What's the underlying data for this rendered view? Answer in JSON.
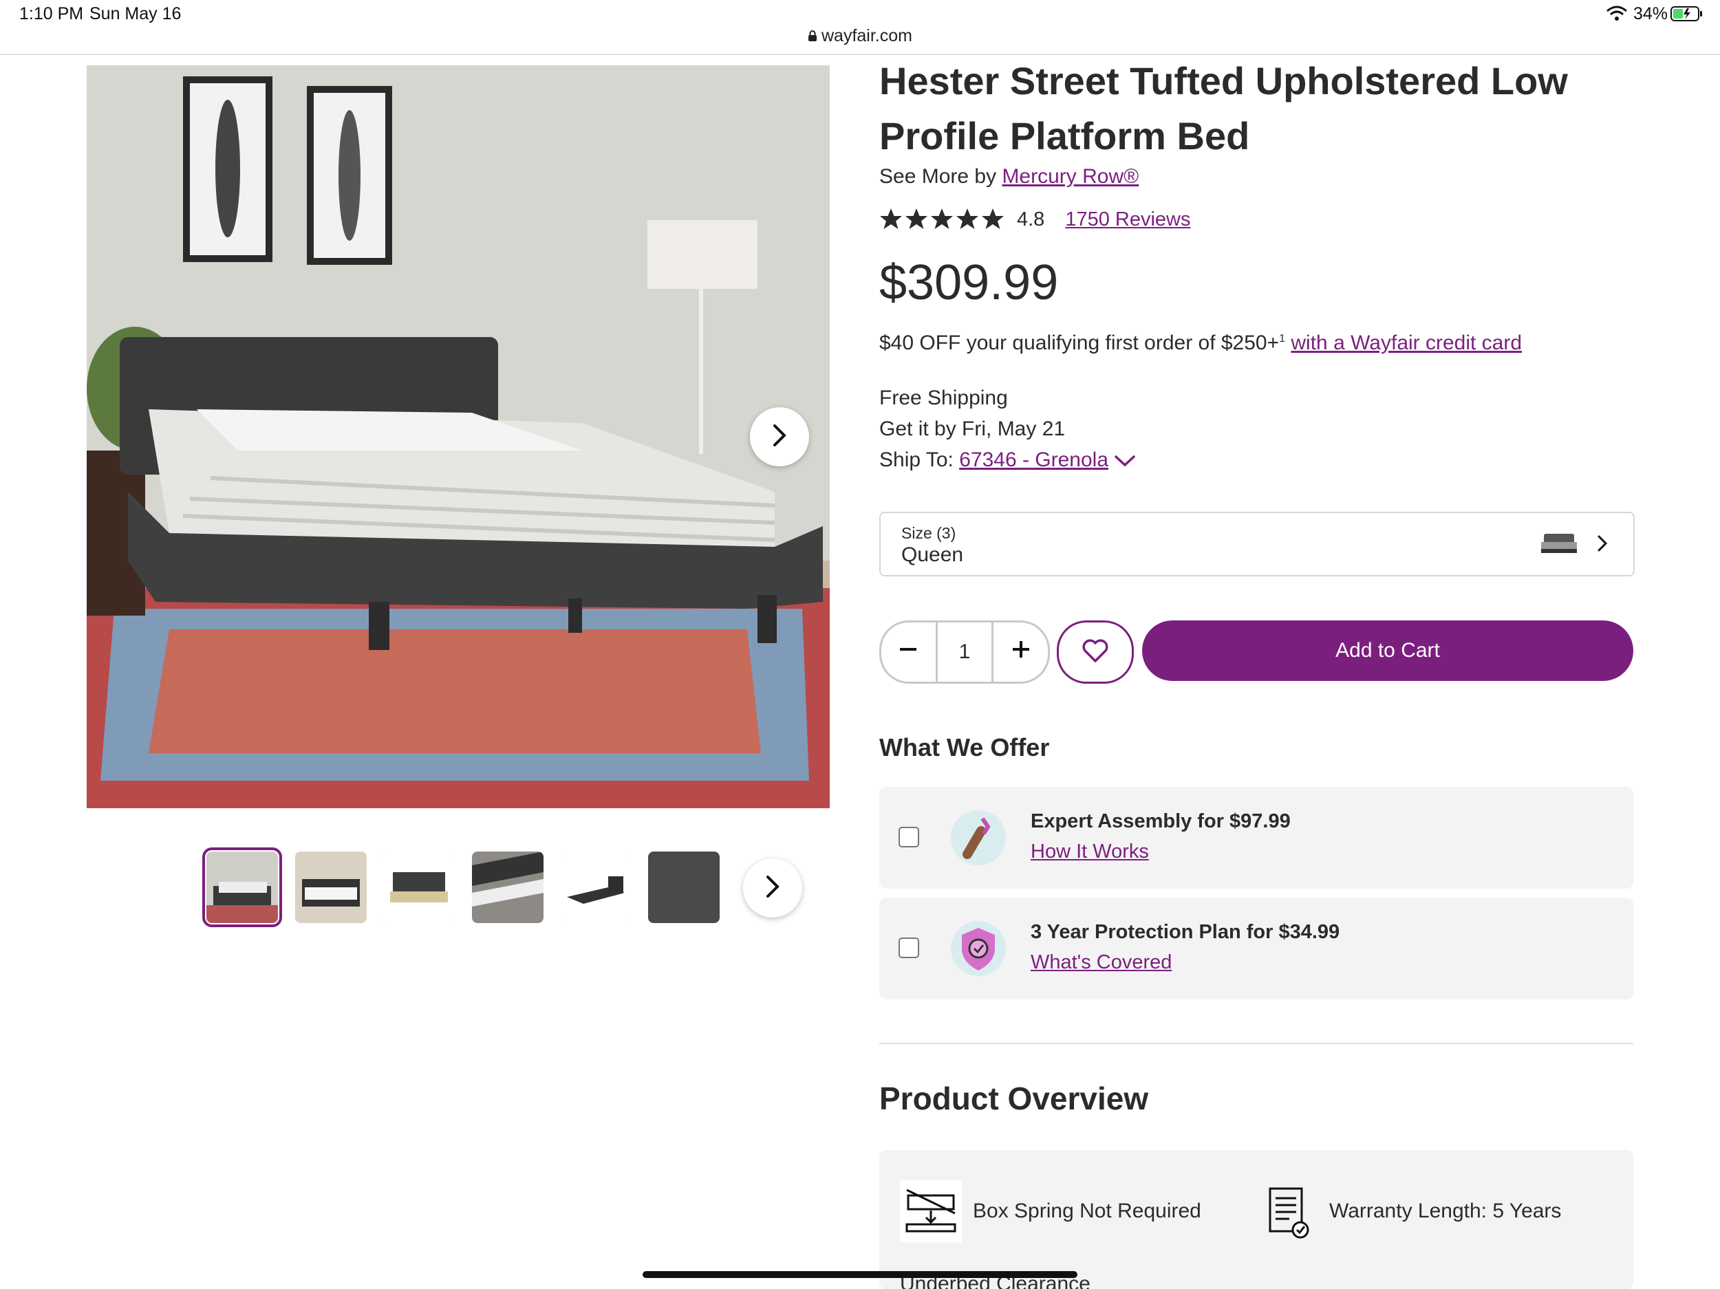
{
  "status_bar": {
    "time": "1:10 PM",
    "date": "Sun May 16",
    "url": "wayfair.com",
    "battery": "34%"
  },
  "product": {
    "title": "Hester Street Tufted Upholstered Low Profile Platform Bed",
    "see_more_prefix": "See More by",
    "brand": "Mercury Row®",
    "rating": "4.8",
    "rating_stars": 5,
    "reviews": "1750 Reviews",
    "price": "$309.99"
  },
  "promo": {
    "text": "$40 OFF your qualifying first order of $250+",
    "footnote": "1",
    "link": "with a Wayfair credit card"
  },
  "shipping": {
    "line1": "Free Shipping",
    "line2": "Get it by Fri, May 21",
    "ship_to_label": "Ship To:",
    "ship_to_value": "67346 - Grenola"
  },
  "size_selector": {
    "label": "Size (3)",
    "value": "Queen"
  },
  "purchase": {
    "quantity": "1",
    "add_to_cart": "Add to Cart"
  },
  "offers": {
    "heading": "What We Offer",
    "items": [
      {
        "title": "Expert Assembly for $97.99",
        "link": "How It Works",
        "icon": "assembly-wrench-icon"
      },
      {
        "title": "3 Year Protection Plan for $34.99",
        "link": "What's Covered",
        "icon": "protection-shield-icon"
      }
    ]
  },
  "overview": {
    "heading": "Product Overview",
    "features": [
      {
        "text": "Box Spring Not Required",
        "icon": "box-spring-icon"
      },
      {
        "text": "Warranty Length: 5 Years",
        "icon": "warranty-document-icon"
      }
    ],
    "partial_next": "Underbed Clearance"
  },
  "colors": {
    "accent": "#7b1f7f",
    "card_bg": "#f3f3f3",
    "text": "#2b2b2b"
  }
}
